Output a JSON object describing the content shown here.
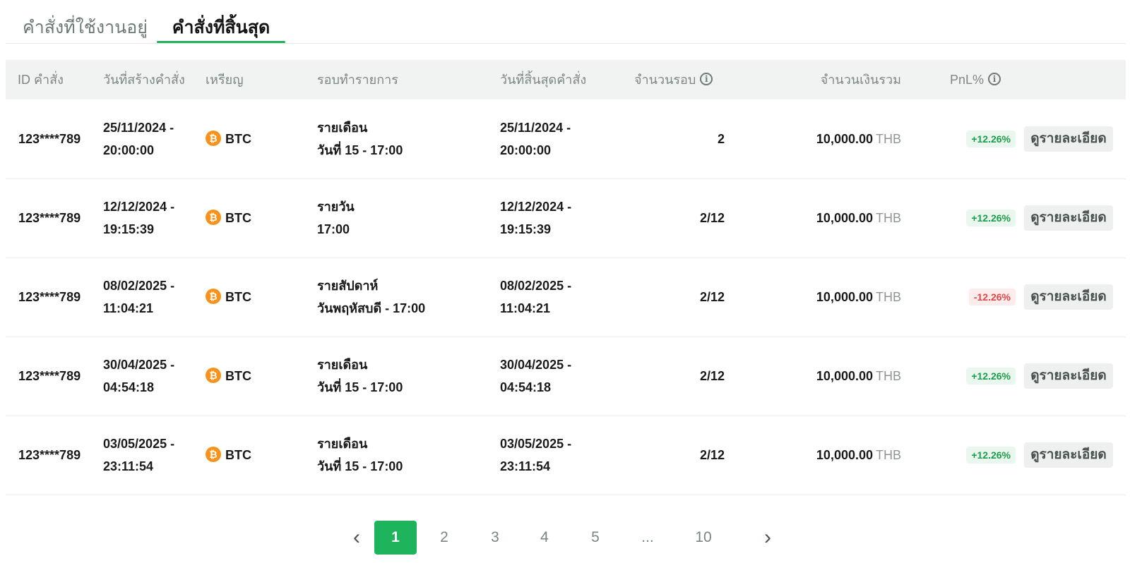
{
  "tabs": {
    "active_orders": "คำสั่งที่ใช้งานอยู่",
    "ended_orders": "คำสั่งที่สิ้นสุด"
  },
  "table": {
    "headers": {
      "id": "ID คำสั่ง",
      "created": "วันที่สร้างคำสั่ง",
      "coin": "เหรียญ",
      "cycle": "รอบทำรายการ",
      "end": "วันที่สิ้นสุดคำสั่ง",
      "rounds": "จำนวนรอบ",
      "amount": "จำนวนเงินรวม",
      "pnl": "PnL%"
    },
    "rows": [
      {
        "id": "123****789",
        "created_date": "25/11/2024 -",
        "created_time": "20:00:00",
        "coin": "BTC",
        "cycle_title": "รายเดือน",
        "cycle_detail": "วันที่ 15 - 17:00",
        "end_date": "25/11/2024 -",
        "end_time": "20:00:00",
        "rounds": "2",
        "amount": "10,000.00",
        "currency": "THB",
        "pnl": "+12.26%",
        "pnl_type": "positive",
        "action": "ดูรายละเอียด"
      },
      {
        "id": "123****789",
        "created_date": "12/12/2024 -",
        "created_time": "19:15:39",
        "coin": "BTC",
        "cycle_title": "รายวัน",
        "cycle_detail": "17:00",
        "end_date": "12/12/2024 -",
        "end_time": "19:15:39",
        "rounds": "2/12",
        "amount": "10,000.00",
        "currency": "THB",
        "pnl": "+12.26%",
        "pnl_type": "positive",
        "action": "ดูรายละเอียด"
      },
      {
        "id": "123****789",
        "created_date": "08/02/2025 -",
        "created_time": "11:04:21",
        "coin": "BTC",
        "cycle_title": "รายสัปดาห์",
        "cycle_detail": "วันพฤหัสบดี - 17:00",
        "end_date": "08/02/2025 -",
        "end_time": "11:04:21",
        "rounds": "2/12",
        "amount": "10,000.00",
        "currency": "THB",
        "pnl": "-12.26%",
        "pnl_type": "negative",
        "action": "ดูรายละเอียด"
      },
      {
        "id": "123****789",
        "created_date": "30/04/2025 -",
        "created_time": "04:54:18",
        "coin": "BTC",
        "cycle_title": "รายเดือน",
        "cycle_detail": "วันที่ 15 - 17:00",
        "end_date": "30/04/2025 -",
        "end_time": "04:54:18",
        "rounds": "2/12",
        "amount": "10,000.00",
        "currency": "THB",
        "pnl": "+12.26%",
        "pnl_type": "positive",
        "action": "ดูรายละเอียด"
      },
      {
        "id": "123****789",
        "created_date": "03/05/2025 -",
        "created_time": "23:11:54",
        "coin": "BTC",
        "cycle_title": "รายเดือน",
        "cycle_detail": "วันที่ 15 - 17:00",
        "end_date": "03/05/2025 -",
        "end_time": "23:11:54",
        "rounds": "2/12",
        "amount": "10,000.00",
        "currency": "THB",
        "pnl": "+12.26%",
        "pnl_type": "positive",
        "action": "ดูรายละเอียด"
      }
    ]
  },
  "pagination": {
    "pages": [
      "1",
      "2",
      "3",
      "4",
      "5",
      "...",
      "10"
    ],
    "current": "1"
  },
  "colors": {
    "accent": "#1db45c",
    "positive": "#1a9c4b",
    "negative": "#e04545",
    "bitcoin": "#f7931a"
  }
}
